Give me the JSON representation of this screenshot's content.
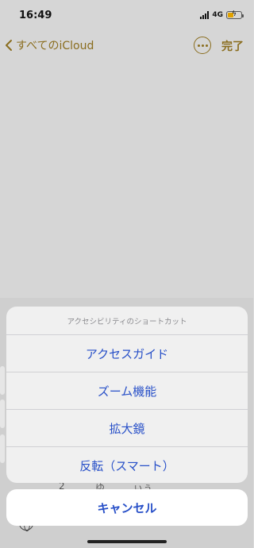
{
  "status_bar": {
    "time": "16:49",
    "network": "4G"
  },
  "nav": {
    "back_label": "すべてのiCloud",
    "done_label": "完了"
  },
  "action_sheet": {
    "title": "アクセシビリティのショートカット",
    "items": [
      {
        "label": "アクセスガイド"
      },
      {
        "label": "ズーム機能"
      },
      {
        "label": "拡大鏡"
      },
      {
        "label": "反転（スマート）"
      }
    ],
    "cancel_label": "キャンセル"
  },
  "keyboard_fragments": {
    "a": "2",
    "b": "ゆ",
    "c": "ぃぅ…"
  },
  "colors": {
    "accent": "#2850c8",
    "notes_accent": "#8a6d1e",
    "battery": "#e0a100"
  },
  "icons": {
    "back": "chevron-left-icon",
    "more": "ellipsis-circle-icon",
    "globe": "globe-icon"
  }
}
